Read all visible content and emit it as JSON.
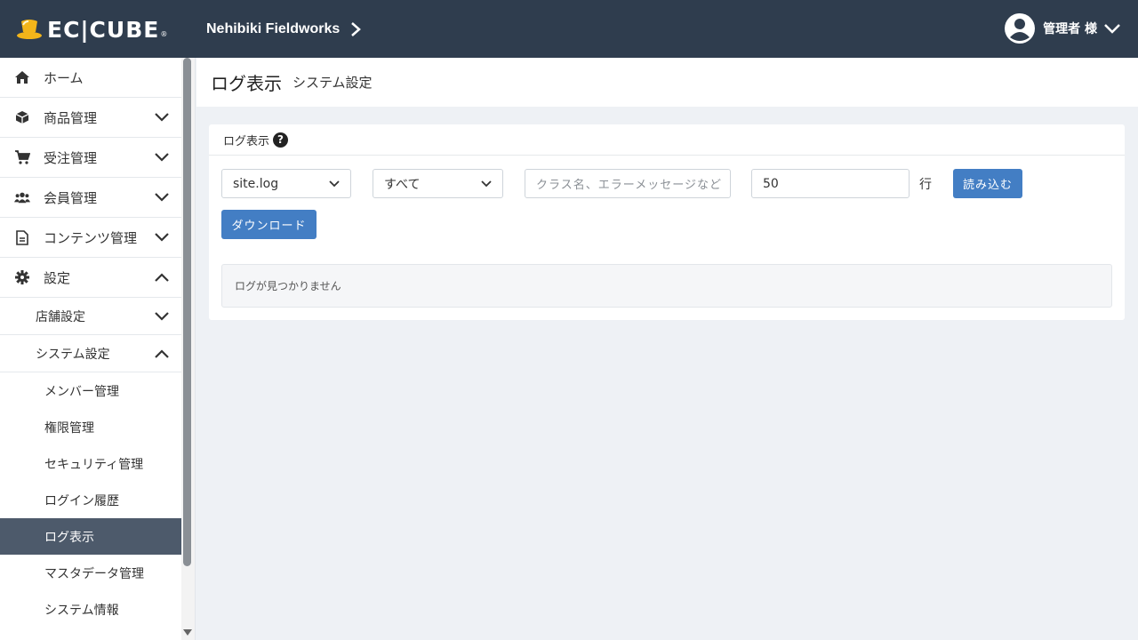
{
  "header": {
    "logo_text": "EC|CUBE",
    "logo_dot": "®",
    "shop_name": "Nehibiki Fieldworks",
    "user_name": "管理者 様"
  },
  "sidebar": {
    "items": [
      {
        "label": "ホーム",
        "icon": "home-icon"
      },
      {
        "label": "商品管理",
        "icon": "cube-icon"
      },
      {
        "label": "受注管理",
        "icon": "cart-icon"
      },
      {
        "label": "会員管理",
        "icon": "users-icon"
      },
      {
        "label": "コンテンツ管理",
        "icon": "file-icon"
      },
      {
        "label": "設定",
        "icon": "gear-icon"
      }
    ],
    "sub_items": [
      {
        "label": "店舗設定"
      },
      {
        "label": "システム設定"
      }
    ],
    "leaf_items": [
      {
        "label": "メンバー管理"
      },
      {
        "label": "権限管理"
      },
      {
        "label": "セキュリティ管理"
      },
      {
        "label": "ログイン履歴"
      },
      {
        "label": "ログ表示"
      },
      {
        "label": "マスタデータ管理"
      },
      {
        "label": "システム情報"
      }
    ],
    "active": "ログ表示"
  },
  "page": {
    "title": "ログ表示",
    "subtitle": "システム設定"
  },
  "card": {
    "title": "ログ表示",
    "help": "?",
    "file_select_value": "site.log",
    "level_select_value": "すべて",
    "keyword_placeholder": "クラス名、エラーメッセージなど",
    "lines_value": "50",
    "lines_unit": "行",
    "load_button": "読み込む",
    "download_button": "ダウンロード",
    "empty_message": "ログが見つかりません"
  },
  "colors": {
    "header_bg": "#2f3d4e",
    "accent": "#437ec4",
    "active_nav": "#4d5a6b",
    "logo_yellow": "#f3b51a"
  }
}
